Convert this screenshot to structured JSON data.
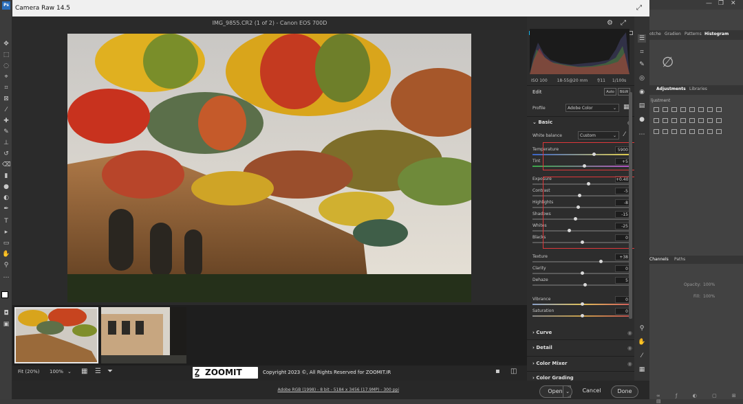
{
  "ps_tabs": {
    "swatches": "otche",
    "gradients": "Gradien",
    "patterns": "Patterns",
    "histogram": "Histogram",
    "adjustments": "Adjustments",
    "libraries": "Libraries",
    "adj_sub": "ljustment",
    "channels": "Channels",
    "paths": "Paths",
    "opacity": "Opacity:",
    "opacity_val": "100%",
    "fill": "Fill:",
    "fill_val": "100%"
  },
  "window": {
    "title": "Camera Raw 14.5"
  },
  "photo": {
    "filename": "IMG_9855.CR2 (1 of 2)  -  Canon EOS 700D"
  },
  "camera_info": {
    "iso": "ISO 100",
    "lens": "18-55@20 mm",
    "aperture": "f/11",
    "shutter": "1/100s"
  },
  "edit": {
    "title": "Edit",
    "auto": "Auto",
    "bw": "B&W"
  },
  "profile": {
    "label": "Profile",
    "value": "Adobe Color"
  },
  "basic": {
    "title": "Basic",
    "wb_label": "White balance",
    "wb_value": "Custom",
    "sliders": [
      {
        "label": "Temperature",
        "value": "5900",
        "pos": 0.62
      },
      {
        "label": "Tint",
        "value": "+5",
        "pos": 0.52
      },
      {
        "label": "Exposure",
        "value": "+0.40",
        "pos": 0.56
      },
      {
        "label": "Contrast",
        "value": "-5",
        "pos": 0.47
      },
      {
        "label": "Highlights",
        "value": "-8",
        "pos": 0.46
      },
      {
        "label": "Shadows",
        "value": "-15",
        "pos": 0.43
      },
      {
        "label": "Whites",
        "value": "-25",
        "pos": 0.37
      },
      {
        "label": "Blacks",
        "value": "0",
        "pos": 0.5
      },
      {
        "label": "Texture",
        "value": "+38",
        "pos": 0.69
      },
      {
        "label": "Clarity",
        "value": "0",
        "pos": 0.5
      },
      {
        "label": "Dehaze",
        "value": "5",
        "pos": 0.53
      },
      {
        "label": "Vibrance",
        "value": "0",
        "pos": 0.5
      },
      {
        "label": "Saturation",
        "value": "0",
        "pos": 0.5
      }
    ]
  },
  "sections": {
    "curve": "Curve",
    "detail": "Detail",
    "color_mixer": "Color Mixer",
    "color_grading": "Color Grading"
  },
  "zoom": {
    "fit": "Fit (20%)",
    "pct": "100%"
  },
  "copyright": {
    "brand": "ZOOMIT",
    "text": "Copyright 2023 ©, All Rights Reserved for ZOOMIT.IR"
  },
  "status": {
    "info": "Adobe RGB (1998) - 8 bit - 5184 x 3456 (17.9MP) - 300 ppi"
  },
  "buttons": {
    "open": "Open",
    "cancel": "Cancel",
    "done": "Done"
  },
  "colors": {
    "accent_red": "#e0383a",
    "panel_bg": "#2d2d2d"
  }
}
